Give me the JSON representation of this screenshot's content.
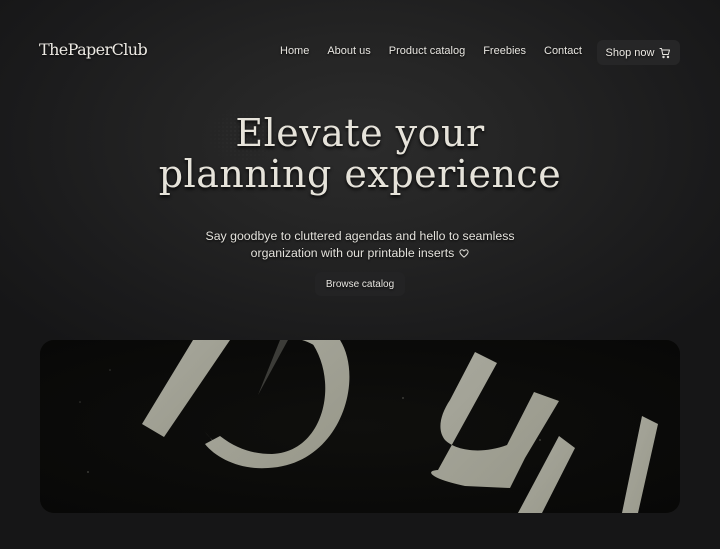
{
  "brand": {
    "logo_text": "ThePaperClub"
  },
  "nav": {
    "items": [
      {
        "label": "Home"
      },
      {
        "label": "About us"
      },
      {
        "label": "Product catalog"
      },
      {
        "label": "Freebies"
      },
      {
        "label": "Contact"
      }
    ],
    "shop_button": {
      "label": "Shop now",
      "icon": "shopping-cart-icon"
    }
  },
  "hero": {
    "title_line1": "Elevate your",
    "title_line2": "planning experience",
    "subtitle_line1": "Say goodbye to cluttered agendas and hello to seamless",
    "subtitle_line2": "organization with our printable inserts",
    "subtitle_icon": "heart-icon",
    "cta_label": "Browse catalog"
  },
  "banner": {
    "image_description": "Close-up of large pale letterforms cut from paper on a black background",
    "letter_color": "#a3a398",
    "background_color": "#0c0c0a"
  },
  "colors": {
    "page_background": "#161617",
    "text": "#e8e6e1",
    "button_background": "#262627"
  }
}
